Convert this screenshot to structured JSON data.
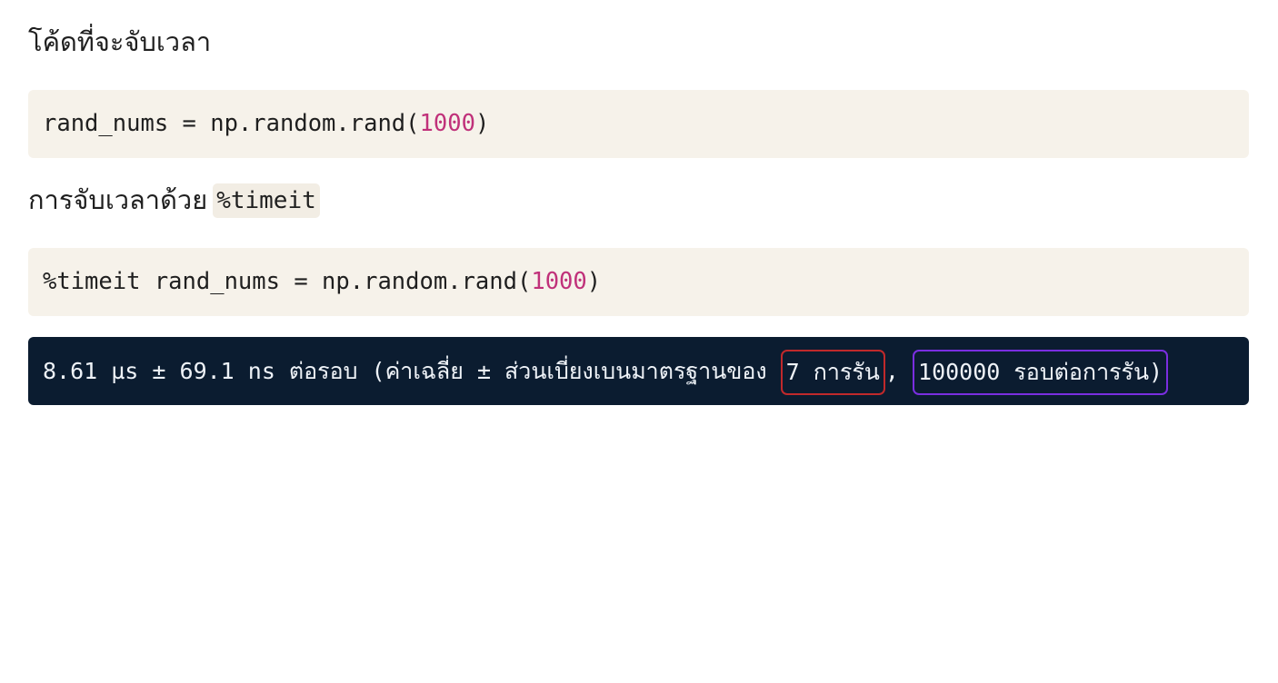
{
  "section1": {
    "heading": "โค้ดที่จะจับเวลา"
  },
  "code1": {
    "prefix": "rand_nums = np.random.rand(",
    "number": "1000",
    "suffix": ")"
  },
  "section2": {
    "heading": "การจับเวลาด้วย",
    "inline_code": "%timeit"
  },
  "code2": {
    "prefix": "%timeit rand_nums = np.random.rand(",
    "number": "1000",
    "suffix": ")"
  },
  "output": {
    "text_before": "8.61 µs ± 69.1 ns ต่อรอบ (ค่าเฉลี่ย ± ส่วนเบี่ยงเบนมาตรฐานของ ",
    "runs_highlight": "7 การรัน",
    "separator": ", ",
    "loops_highlight": "100000 รอบต่อการรัน)",
    "highlight_colors": {
      "runs": "#c0292b",
      "loops": "#7a2ee0"
    }
  },
  "colors": {
    "code_background": "#f6f2ea",
    "output_background": "#0b1c30",
    "number_literal": "#c0317a"
  }
}
